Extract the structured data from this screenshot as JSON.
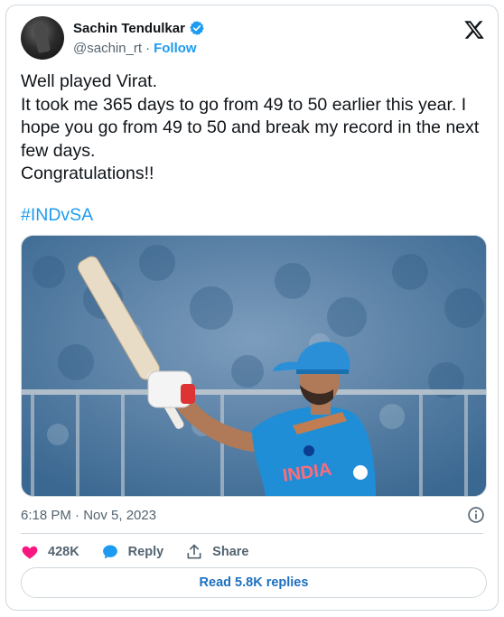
{
  "author": {
    "name": "Sachin Tendulkar",
    "handle": "@sachin_rt",
    "separator": "·",
    "follow_label": "Follow",
    "verified_color": "#1d9bf0"
  },
  "tweet": {
    "lines": [
      "Well played Virat.",
      "It took me 365 days to go from 49 to 50 earlier this year. I hope you go from 49 to 50 and break my record in the next few days.",
      "Congratulations!!"
    ],
    "hashtag": "#INDvSA"
  },
  "photo": {
    "alt_subject": "cricketer raising bat",
    "shirt_text": "INDIA"
  },
  "meta": {
    "timestamp": "6:18 PM · Nov 5, 2023"
  },
  "actions": {
    "likes": "428K",
    "reply_label": "Reply",
    "share_label": "Share"
  },
  "replies_button": "Read 5.8K replies",
  "icons": {
    "like": "heart-icon",
    "reply": "speech-bubble-icon",
    "share": "upload-icon",
    "brand": "x-logo-icon",
    "info": "info-icon"
  },
  "colors": {
    "accent": "#1d9bf0",
    "like": "#f91880",
    "text": "#0f1419",
    "muted": "#536471"
  }
}
